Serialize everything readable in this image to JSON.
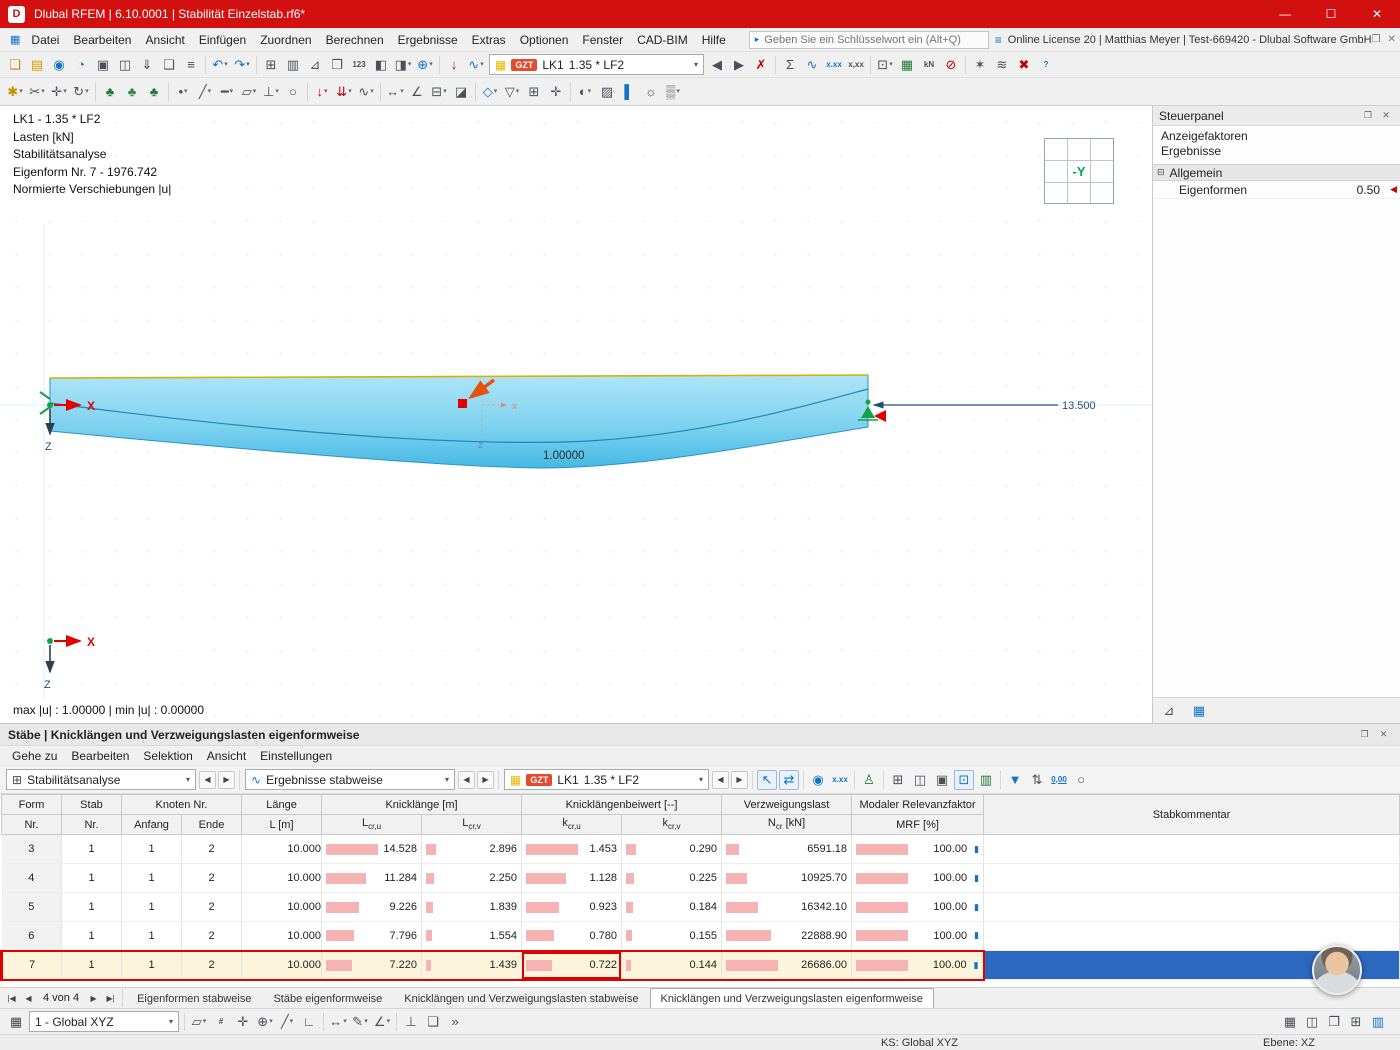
{
  "titlebar": {
    "logo": "D",
    "title": "Dlubal RFEM | 6.10.0001 | Stabilität Einzelstab.rf6*",
    "minimize": "—",
    "maximize": "☐",
    "close": "✕"
  },
  "menubar": {
    "items": [
      "Datei",
      "Bearbeiten",
      "Ansicht",
      "Einfügen",
      "Zuordnen",
      "Berechnen",
      "Ergebnisse",
      "Extras",
      "Optionen",
      "Fenster",
      "CAD-BIM",
      "Hilfe"
    ],
    "search_icon": "▸",
    "search_placeholder": "Geben Sie ein Schlüsselwort ein (Alt+Q)",
    "keyword_icon": "≡",
    "license": "Online License 20 | Matthias Meyer | Test-669420 - Dlubal Software GmbH"
  },
  "load_combo": {
    "badge": "GZT",
    "case": "LK1",
    "loadcase": "1.35 * LF2"
  },
  "viewport": {
    "annotations": [
      "LK1 - 1.35 * LF2",
      "Lasten [kN]",
      "Stabilitätsanalyse",
      "Eigenform Nr. 7 - 1976.742",
      "Normierte Verschiebungen |u|"
    ],
    "result_value": "1.00000",
    "dimension": "13.500",
    "axis_x": "X",
    "axis_z": "Z",
    "local_x": "x",
    "local_z": "z",
    "viewcube_face": "-Y",
    "status": "max |u| : 1.00000 | min |u| : 0.00000"
  },
  "steuerpanel": {
    "title": "Steuerpanel",
    "sections": [
      "Anzeigefaktoren",
      "Ergebnisse"
    ],
    "group": "Allgemein",
    "expander": "⊟",
    "factor_label": "Eigenformen",
    "factor_value": "0.50",
    "marker": "◀"
  },
  "grid_panel": {
    "title": "Stäbe | Knicklängen und Verzweigungslasten eigenformweise",
    "menu": [
      "Gehe zu",
      "Bearbeiten",
      "Selektion",
      "Ansicht",
      "Einstellungen"
    ],
    "analysis_combo": "Stabilitätsanalyse",
    "results_combo": "Ergebnisse stabweise",
    "columns": {
      "form_l1": "Form",
      "form_l2": "Nr.",
      "stab_l1": "Stab",
      "stab_l2": "Nr.",
      "knoten_l1": "Knoten Nr.",
      "knoten_anfang": "Anfang",
      "knoten_ende": "Ende",
      "laenge_l1": "Länge",
      "laenge_l2": "L [m]",
      "knick_l1": "Knicklänge [m]",
      "beiwert_l1": "Knicklängenbeiwert [--]",
      "lcr_t": "L",
      "lcru_s": "cr,u",
      "lcrv_s": "cr,v",
      "kcr_t": "k",
      "kcru_s": "cr,u",
      "kcrv_s": "cr,v",
      "ncr_l1": "Verzweigungslast",
      "ncr_t": "N",
      "ncr_s": "cr",
      "ncr_unit": " [kN]",
      "mrf_l1": "Modaler Relevanzfaktor",
      "mrf_l2": "MRF [%]",
      "kommentar": "Stabkommentar"
    },
    "rows": [
      {
        "form": "3",
        "stab": "1",
        "anfang": "1",
        "ende": "2",
        "laenge": "10.000",
        "lcru": "14.528",
        "lcrv": "2.896",
        "kcru": "1.453",
        "kcrv": "0.290",
        "ncr": "6591.18",
        "mrf": "100.00",
        "selected": false
      },
      {
        "form": "4",
        "stab": "1",
        "anfang": "1",
        "ende": "2",
        "laenge": "10.000",
        "lcru": "11.284",
        "lcrv": "2.250",
        "kcru": "1.128",
        "kcrv": "0.225",
        "ncr": "10925.70",
        "mrf": "100.00",
        "selected": false
      },
      {
        "form": "5",
        "stab": "1",
        "anfang": "1",
        "ende": "2",
        "laenge": "10.000",
        "lcru": "9.226",
        "lcrv": "1.839",
        "kcru": "0.923",
        "kcrv": "0.184",
        "ncr": "16342.10",
        "mrf": "100.00",
        "selected": false
      },
      {
        "form": "6",
        "stab": "1",
        "anfang": "1",
        "ende": "2",
        "laenge": "10.000",
        "lcru": "7.796",
        "lcrv": "1.554",
        "kcru": "0.780",
        "kcrv": "0.155",
        "ncr": "22888.90",
        "mrf": "100.00",
        "selected": false
      },
      {
        "form": "7",
        "stab": "1",
        "anfang": "1",
        "ende": "2",
        "laenge": "10.000",
        "lcru": "7.220",
        "lcrv": "1.439",
        "kcru": "0.722",
        "kcrv": "0.144",
        "ncr": "26686.00",
        "mrf": "100.00",
        "selected": true
      }
    ],
    "nav": {
      "first": "|◀",
      "prev": "◀",
      "next": "▶",
      "last": "▶|"
    },
    "pager": "4 von 4",
    "tabs": [
      "Eigenformen stabweise",
      "Stäbe eigenformweise",
      "Knicklängen und Verzweigungslasten stabweise",
      "Knicklängen und Verzweigungslasten eigenformweise"
    ],
    "active_tab": 3
  },
  "bottom_toolbar": {
    "coord_system": "1 - Global XYZ"
  },
  "statusbar": {
    "ks": "KS: Global XYZ",
    "ebene": "Ebene: XZ"
  },
  "icons": {
    "main1a": [
      {
        "n": "new-model-icon",
        "g": "❏",
        "c": "#b8860b"
      },
      {
        "n": "open-model-icon",
        "g": "▤",
        "c": "#d89b00"
      },
      {
        "n": "dlubal-center-icon",
        "g": "◉",
        "c": "#1273c8"
      },
      {
        "n": "teamwork-icon",
        "g": "◔",
        "c": "#1273c8"
      },
      {
        "n": "save-icon",
        "g": "▣",
        "c": "#4a5058"
      },
      {
        "n": "print-icon",
        "g": "◫",
        "c": "#4a5058"
      },
      {
        "n": "export-icon",
        "g": "⇓",
        "c": "#4a5058"
      },
      {
        "n": "copy-icon",
        "g": "❑",
        "c": "#4a5058"
      },
      {
        "n": "clipboard-icon",
        "g": "≡",
        "c": "#4a5058"
      },
      {
        "sep": true
      },
      {
        "n": "undo-icon",
        "g": "↶",
        "c": "#1273c8",
        "dd": true
      },
      {
        "n": "redo-icon",
        "g": "↷",
        "c": "#1273c8",
        "dd": true
      },
      {
        "sep": true
      },
      {
        "n": "tables-icon",
        "g": "⊞",
        "c": "#4a5058"
      },
      {
        "n": "printout-report-icon",
        "g": "▥",
        "c": "#4a5058"
      },
      {
        "n": "measure-icon",
        "g": "⊿",
        "c": "#4a5058"
      },
      {
        "n": "graphic-window-icon",
        "g": "❐",
        "c": "#4a5058"
      },
      {
        "n": "renumber-icon",
        "g": "123",
        "t": 1,
        "c": "#4a5058"
      },
      {
        "n": "display-properties-icon",
        "g": "◧",
        "c": "#4a5058"
      },
      {
        "n": "render-mode-icon",
        "g": "◨",
        "c": "#4a5058",
        "dd": true
      },
      {
        "n": "visibility-states-icon",
        "g": "⊕",
        "c": "#1273c8",
        "dd": true
      },
      {
        "sep": true
      },
      {
        "n": "show-loads-icon",
        "g": "↓",
        "c": "#c00000"
      },
      {
        "n": "show-results-icon",
        "g": "∿",
        "c": "#1273c8",
        "dd": true
      }
    ],
    "main1b": [
      {
        "n": "previous-loadcase-button",
        "g": "◀",
        "c": "#4a5058"
      },
      {
        "n": "next-loadcase-button",
        "g": "▶",
        "c": "#4a5058"
      },
      {
        "n": "delete-results-icon",
        "g": "✗",
        "c": "#c00000"
      },
      {
        "sep": true
      },
      {
        "n": "calculate-all-icon",
        "g": "Σ",
        "c": "#4a5058"
      },
      {
        "n": "calculation-diagrams-icon",
        "g": "∿",
        "c": "#1273c8"
      },
      {
        "n": "result-values-icon",
        "g": "x.xx",
        "t": 1,
        "c": "#1273c8"
      },
      {
        "n": "result-loupe-icon",
        "g": "x,xx",
        "t": 1,
        "c": "#4a5058"
      },
      {
        "sep": true
      },
      {
        "n": "panels-icon",
        "g": "⊡",
        "c": "#4a5058",
        "dd": true
      },
      {
        "n": "excel-export-icon",
        "g": "▦",
        "c": "#1e7b34"
      },
      {
        "n": "units-settings-icon",
        "g": "kN",
        "t": 1,
        "c": "#4a5058"
      },
      {
        "n": "stop-calculation-icon",
        "g": "⊘",
        "c": "#c00000"
      },
      {
        "sep": true
      },
      {
        "n": "generators-icon",
        "g": "✶",
        "c": "#4a5058"
      },
      {
        "n": "program-settings-icon",
        "g": "≋",
        "c": "#4a5058"
      },
      {
        "n": "close-results-icon",
        "g": "✖",
        "c": "#c00000"
      },
      {
        "n": "help-icon",
        "g": "?",
        "t": 1,
        "c": "#1273c8"
      }
    ],
    "main2": [
      {
        "n": "generate-model-icon",
        "g": "✱",
        "c": "#c79200",
        "dd": true
      },
      {
        "n": "trim-icon",
        "g": "✂",
        "c": "#4a5058",
        "dd": true
      },
      {
        "n": "move-copy-icon",
        "g": "✛",
        "c": "#4a5058",
        "dd": true
      },
      {
        "n": "rotate-icon",
        "g": "↻",
        "c": "#4a5058",
        "dd": true
      },
      {
        "sep": true
      },
      {
        "n": "generate-nodes-icon",
        "g": "♣",
        "c": "#1e7b34"
      },
      {
        "n": "generate-members-icon",
        "g": "♣",
        "c": "#2e8b44"
      },
      {
        "n": "generate-surfaces-icon",
        "g": "♣",
        "c": "#1e7b34"
      },
      {
        "sep": true
      },
      {
        "n": "new-node-icon",
        "g": "•",
        "c": "#4a5058",
        "dd": true
      },
      {
        "n": "new-line-icon",
        "g": "╱",
        "c": "#4a5058",
        "dd": true
      },
      {
        "n": "new-member-icon",
        "g": "━",
        "c": "#4a5058",
        "dd": true
      },
      {
        "n": "new-surface-icon",
        "g": "▱",
        "c": "#4a5058",
        "dd": true
      },
      {
        "n": "new-support-icon",
        "g": "⊥",
        "c": "#4a5058",
        "dd": true
      },
      {
        "n": "new-hinge-icon",
        "g": "○",
        "c": "#4a5058"
      },
      {
        "sep": true
      },
      {
        "n": "new-nodal-load-icon",
        "g": "↓",
        "c": "#c00000",
        "dd": true
      },
      {
        "n": "new-line-load-icon",
        "g": "⇊",
        "c": "#c00000",
        "dd": true
      },
      {
        "n": "new-imperfection-icon",
        "g": "∿",
        "c": "#4a5058",
        "dd": true
      },
      {
        "sep": true
      },
      {
        "n": "dimension-icon",
        "g": "↔",
        "c": "#4a5058",
        "dd": true
      },
      {
        "n": "angle-measure-icon",
        "g": "∠",
        "c": "#4a5058"
      },
      {
        "n": "section-icon",
        "g": "⊟",
        "c": "#4a5058",
        "dd": true
      },
      {
        "n": "clipping-box-icon",
        "g": "◪",
        "c": "#4a5058"
      },
      {
        "sep": true
      },
      {
        "n": "isometric-view-icon",
        "g": "◇",
        "c": "#1273c8",
        "dd": true
      },
      {
        "n": "view-in-direction-icon",
        "g": "▽",
        "c": "#4a5058",
        "dd": true
      },
      {
        "n": "zoom-window-icon",
        "g": "⊞",
        "c": "#4a5058"
      },
      {
        "n": "pan-view-icon",
        "g": "✛",
        "c": "#4a5058"
      },
      {
        "sep": true
      },
      {
        "n": "visibility-mode-icon",
        "g": "◐",
        "c": "#4a5058",
        "dd": true
      },
      {
        "n": "user-visibility-icon",
        "g": "▨",
        "c": "#4a5058"
      },
      {
        "n": "color-scale-icon",
        "g": "▌",
        "c": "#1273c8"
      },
      {
        "n": "lighting-icon",
        "g": "☼",
        "c": "#4a5058"
      },
      {
        "n": "background-color-icon",
        "g": "▒",
        "c": "#4a5058",
        "dd": true
      }
    ],
    "table_icons": [
      {
        "n": "pick-rows-in-graphic-icon",
        "g": "↖",
        "c": "#1273c8",
        "box": 1
      },
      {
        "n": "sync-selection-icon",
        "g": "⇄",
        "c": "#1273c8",
        "box": 1
      },
      {
        "sep": true
      },
      {
        "n": "show-values-in-graphic-icon",
        "g": "◉",
        "c": "#1273c8"
      },
      {
        "n": "table-values-icon",
        "g": "x.xx",
        "t": 1,
        "c": "#1273c8"
      },
      {
        "sep": true
      },
      {
        "n": "relevant-results-icon",
        "g": "♙",
        "c": "#1e7b34"
      },
      {
        "sep": true
      },
      {
        "n": "table-view-icon",
        "g": "⊞",
        "c": "#4a5058"
      },
      {
        "n": "print-table-icon",
        "g": "◫",
        "c": "#4a5058"
      },
      {
        "n": "save-table-icon",
        "g": "▣",
        "c": "#4a5058"
      },
      {
        "n": "dock-table-icon",
        "g": "⊡",
        "c": "#1273c8",
        "box": 1
      },
      {
        "n": "export-table-icon",
        "g": "▥",
        "c": "#1e7b34"
      },
      {
        "sep": true
      },
      {
        "n": "filter-rows-icon",
        "g": "▼",
        "c": "#1273c8"
      },
      {
        "n": "sort-rows-icon",
        "g": "⇅",
        "c": "#4a5058"
      },
      {
        "n": "hide-zero-rows-icon",
        "g": "0,00",
        "t": 1,
        "c": "#1273c8",
        "u": 1
      },
      {
        "n": "search-table-icon",
        "g": "○",
        "c": "#4a5058"
      }
    ],
    "bottom_icons": [
      {
        "sep": true
      },
      {
        "n": "work-plane-icon",
        "g": "▱",
        "c": "#4a5058",
        "dd": true
      },
      {
        "n": "grid-settings-icon",
        "g": "#",
        "t": 1,
        "c": "#4a5058"
      },
      {
        "n": "snap-icon",
        "g": "✛",
        "c": "#4a5058"
      },
      {
        "n": "object-snap-icon",
        "g": "⊕",
        "c": "#4a5058",
        "dd": true
      },
      {
        "n": "guidelines-icon",
        "g": "╱",
        "c": "#4a5058",
        "dd": true
      },
      {
        "n": "ortho-mode-icon",
        "g": "∟",
        "c": "#4a5058"
      },
      {
        "sep": true
      },
      {
        "n": "dimensions-icon",
        "g": "↔",
        "c": "#4a5058",
        "dd": true
      },
      {
        "n": "comments-icon",
        "g": "✎",
        "c": "#4a5058",
        "dd": true
      },
      {
        "n": "measure-tool-icon",
        "g": "∠",
        "c": "#4a5058",
        "dd": true
      },
      {
        "sep": true
      },
      {
        "n": "supports-display-icon",
        "g": "⊥",
        "c": "#4a5058"
      },
      {
        "n": "layers-icon",
        "g": "❏",
        "c": "#4a5058"
      },
      {
        "n": "overflow-button",
        "g": "»",
        "c": "#4a5058"
      }
    ],
    "bottom_right_icons": [
      {
        "n": "table-layout-icon",
        "g": "▦",
        "c": "#4a5058"
      },
      {
        "n": "split-view-icon",
        "g": "◫",
        "c": "#4a5058"
      },
      {
        "n": "dock-layout-icon",
        "g": "❐",
        "c": "#4a5058"
      },
      {
        "n": "maximize-table-icon",
        "g": "⊞",
        "c": "#4a5058"
      },
      {
        "n": "report-panel-icon",
        "g": "▥",
        "c": "#1273c8"
      }
    ],
    "steuerpanel_icons": [
      {
        "n": "display-factors-icon",
        "g": "⊿",
        "c": "#4a5058"
      },
      {
        "n": "panel-settings-icon",
        "g": "▦",
        "c": "#1273c8"
      }
    ],
    "sp_header_icons": [
      {
        "n": "float-panel-icon",
        "g": "❐",
        "c": "#666666"
      },
      {
        "n": "close-panel-icon",
        "g": "✕",
        "c": "#666666"
      }
    ],
    "gp_header_icons": [
      {
        "n": "float-table-panel-icon",
        "g": "❐",
        "c": "#666666"
      },
      {
        "n": "close-table-panel-icon",
        "g": "✕",
        "c": "#666666"
      }
    ]
  }
}
